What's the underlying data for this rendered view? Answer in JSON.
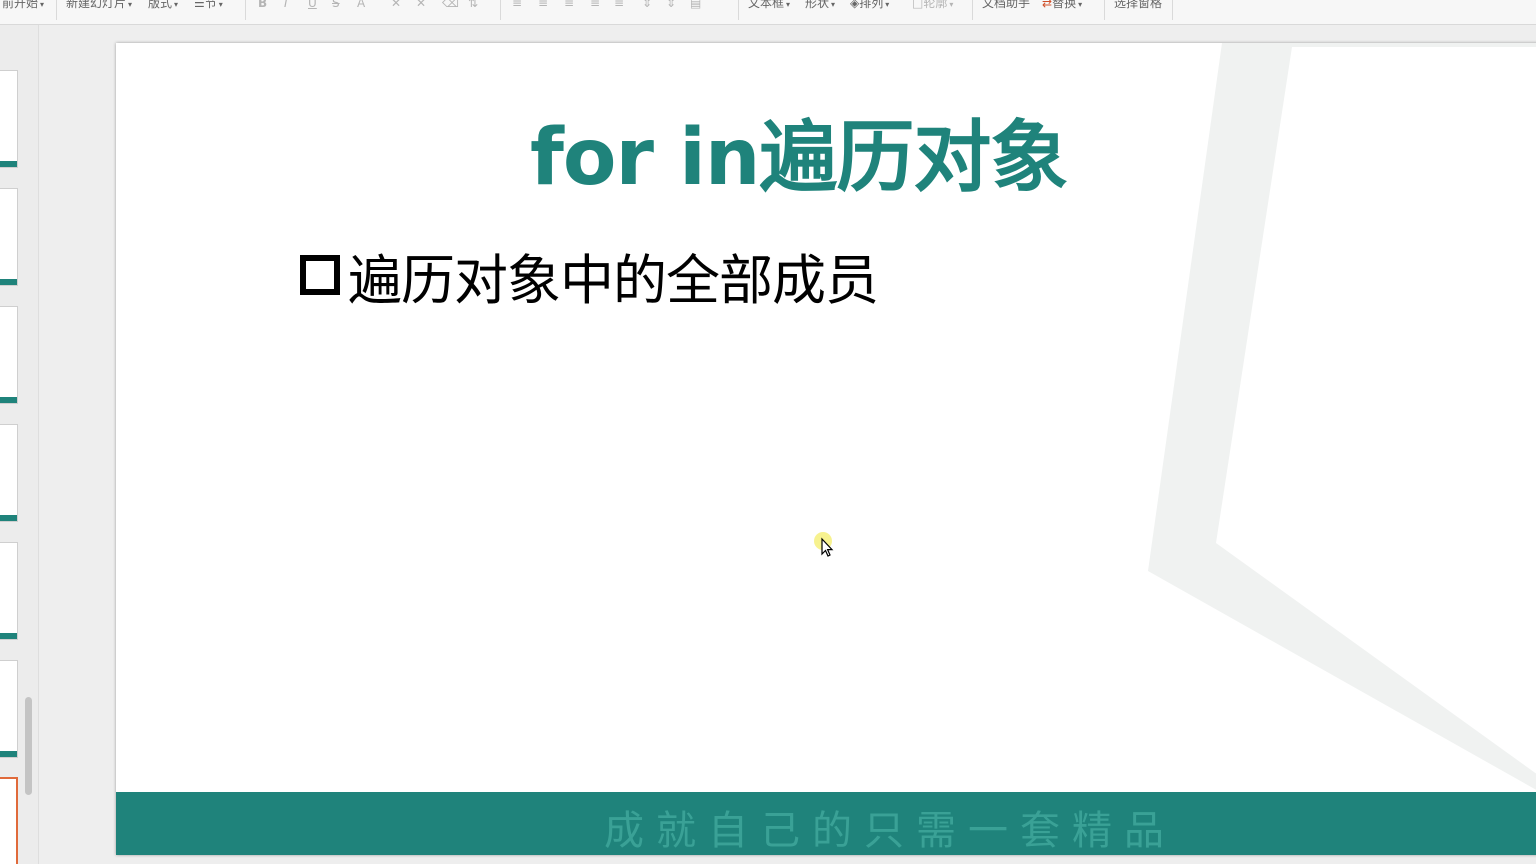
{
  "toolbar": {
    "items": [
      {
        "label": "前开始",
        "has_dropdown": true,
        "enabled": true
      },
      {
        "label": "新建幻灯片",
        "has_dropdown": true,
        "enabled": true
      },
      {
        "label": "版式",
        "has_dropdown": true,
        "enabled": true
      },
      {
        "label": "节",
        "has_dropdown": true,
        "enabled": true
      },
      {
        "label": "B",
        "enabled": false
      },
      {
        "label": "I",
        "enabled": false
      },
      {
        "label": "U",
        "enabled": false
      },
      {
        "label": "S",
        "enabled": false
      },
      {
        "label": "A",
        "enabled": false
      },
      {
        "label": "文本框",
        "has_dropdown": true,
        "enabled": true
      },
      {
        "label": "形状",
        "has_dropdown": true,
        "enabled": true
      },
      {
        "label": "排列",
        "has_dropdown": true,
        "enabled": true
      },
      {
        "label": "轮廓",
        "has_dropdown": true,
        "enabled": false
      },
      {
        "label": "文档助手",
        "enabled": true
      },
      {
        "label": "替换",
        "has_dropdown": true,
        "enabled": true
      },
      {
        "label": "选择窗格",
        "enabled": true
      }
    ]
  },
  "thumbnails": {
    "count": 7,
    "active_index": 6
  },
  "slide": {
    "title": "for in遍历对象",
    "bullets": [
      "遍历对象中的全部成员"
    ],
    "footer_slogan": "成就自己的只需一套精品"
  },
  "colors": {
    "accent": "#1f837b",
    "active_thumb_border": "#e06a3b",
    "decor_gray": "#f0f2f1"
  },
  "icons": {
    "bullet": "hollow-square-bullet-icon",
    "cursor": "mouse-pointer-icon"
  }
}
